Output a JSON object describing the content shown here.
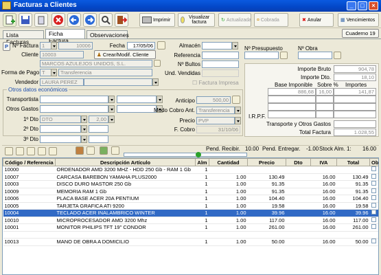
{
  "window": {
    "title": "Facturas a Clientes"
  },
  "toolbar": {
    "imprimir": "Imprimir",
    "visualizar": "Visualizar factura",
    "actualizada": "Actualizada",
    "cobrada": "Cobrada",
    "anular": "Anular",
    "vencimientos": "Vencimientos"
  },
  "tabs": [
    "Lista Facturas",
    "Ficha Factura",
    "Observaciones"
  ],
  "cuaderno": "Cuaderno 19",
  "header": {
    "p_btn": "P",
    "num_factura_label": "Nº Factura",
    "serie": "1",
    "num_factura": "10006",
    "fecha_label": "Fecha",
    "fecha": "17/05/06",
    "almacen_label": "Almacén",
    "cliente_label": "Cliente",
    "cliente_code": "10003",
    "crear_cliente": "Crear/Modif. Cliente",
    "cliente_nombre": "MARCOS AZULEJOS UNIDOS, S.L.",
    "referencia_label": "Referencia",
    "bultos_label": "Nº Bultos",
    "forma_pago_label": "Forma de Pago",
    "forma_pago_code": "T",
    "forma_pago": "Transferencia",
    "und_vendidas_label": "Und. Vendidas",
    "vendedor_label": "Vendedor",
    "vendedor": "LAURA PEREZ",
    "factura_impresa": "Factura Impresa",
    "presupuesto_label": "Nº Presupuesto",
    "obra_label": "Nº Obra"
  },
  "otros": {
    "legend": "Otros datos económicos",
    "transportista_label": "Transportista",
    "otros_gastos_label": "Otros Gastos",
    "dto1_label": "1º Dto",
    "dto1_code": "DTO",
    "dto1_value": "2,00",
    "dto2_label": "2º Dto",
    "dto3_label": "3º Dto",
    "anticipo_label": "Anticipo",
    "anticipo": "500,00",
    "modo_cobro_label": "Modo Cobro Ant.",
    "modo_cobro": "Transferencia",
    "precio_label": "Precio",
    "precio": "PVP",
    "f_cobro_label": "F. Cobro",
    "f_cobro": "31/10/06"
  },
  "totals": {
    "importe_bruto_label": "Importe Bruto",
    "importe_bruto": "904,78",
    "importe_dto_label": "Importe Dto.",
    "importe_dto": "18,10",
    "base_imponible_label": "Base Imponible",
    "sobre_label": "Sobre %",
    "importes_label": "Importes",
    "base_imponible": "886,68",
    "sobre": "16,00",
    "importe_iva": "141,87",
    "irpf_label": "I.R.P.F.",
    "transporte_label": "Transporte y Otros Gastos",
    "total_label": "Total Factura",
    "total": "1.028,55"
  },
  "status": {
    "pend_recibir_label": "Pend. Recibir.",
    "pend_recibir": "10.00",
    "pend_entregar_label": "Pend. Entregar.",
    "pend_entregar": "-1.00",
    "stock_label": "Stock Alm. 1:",
    "stock": "16.00"
  },
  "grid": {
    "columns": [
      "Código / Referencia",
      "Descripción Artículo",
      "Alm",
      "Cantidad",
      "Precio",
      "Dto",
      "IVA",
      "Total",
      "Obs"
    ],
    "rows": [
      {
        "codigo": "10000",
        "desc": "ORDENADOR AMD 3200 MHZ - HDD 250 Gb - RAM 1 Gb",
        "alm": "1",
        "cant": "",
        "precio": "",
        "dto": "",
        "iva": "",
        "total": "",
        "sel": false
      },
      {
        "codigo": "10007",
        "desc": "CARCASA BAREBON YAMAHA PLUS2000",
        "alm": "1",
        "cant": "1.00",
        "precio": "130.49",
        "dto": "",
        "iva": "16.00",
        "total": "130.49",
        "sel": false
      },
      {
        "codigo": "10003",
        "desc": "DISCO DURO MASTOR 250 Gb",
        "alm": "1",
        "cant": "1.00",
        "precio": "91.35",
        "dto": "",
        "iva": "16.00",
        "total": "91.35",
        "sel": false
      },
      {
        "codigo": "10009",
        "desc": "MEMORIA RAM 1 Gb",
        "alm": "1",
        "cant": "1.00",
        "precio": "91.35",
        "dto": "",
        "iva": "16.00",
        "total": "91.35",
        "sel": false
      },
      {
        "codigo": "10006",
        "desc": "PLACA BASE ACER 20A PENTIUM",
        "alm": "1",
        "cant": "1.00",
        "precio": "104.40",
        "dto": "",
        "iva": "16.00",
        "total": "104.40",
        "sel": false
      },
      {
        "codigo": "10005",
        "desc": "TARJETA GRAFICA ATI 9200",
        "alm": "1",
        "cant": "1.00",
        "precio": "19.58",
        "dto": "",
        "iva": "16.00",
        "total": "19.58",
        "sel": false
      },
      {
        "codigo": "10004",
        "desc": "TECLADO ACER INALAMBRICO WINTER",
        "alm": "1",
        "cant": "1.00",
        "precio": "39.96",
        "dto": "",
        "iva": "16.00",
        "total": "39.96",
        "sel": true
      },
      {
        "codigo": "10010",
        "desc": "MICROPROCESADOR AMD 3200 Mhz",
        "alm": "1",
        "cant": "1.00",
        "precio": "117.00",
        "dto": "",
        "iva": "16.00",
        "total": "117.00",
        "sel": false
      },
      {
        "codigo": "10001",
        "desc": "MONITOR PHILIPS TFT 19\" CONDOR",
        "alm": "1",
        "cant": "1.00",
        "precio": "261.00",
        "dto": "",
        "iva": "16.00",
        "total": "261.00",
        "sel": false
      },
      {
        "codigo": "",
        "desc": "",
        "alm": "",
        "cant": "",
        "precio": "",
        "dto": "",
        "iva": "",
        "total": "",
        "sel": false
      },
      {
        "codigo": "10013",
        "desc": "MANO DE OBRA A DOMICILIO",
        "alm": "1",
        "cant": "1.00",
        "precio": "50.00",
        "dto": "",
        "iva": "16.00",
        "total": "50.00",
        "sel": false
      }
    ]
  }
}
